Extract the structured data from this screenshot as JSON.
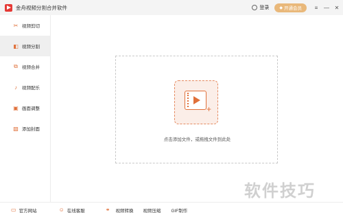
{
  "titlebar": {
    "app_title": "金舟视频分割合并软件",
    "login_label": "登录",
    "vip_label": "开通会员",
    "vip_icon": "diamond-icon",
    "menu_glyph": "≡",
    "minimize_glyph": "—",
    "close_glyph": "✕"
  },
  "sidebar": {
    "items": [
      {
        "label": "视频剪切",
        "icon": "scissors-icon",
        "glyph": "✂"
      },
      {
        "label": "视频分割",
        "icon": "split-icon",
        "glyph": "◧"
      },
      {
        "label": "视频合并",
        "icon": "merge-icon",
        "glyph": "⧉"
      },
      {
        "label": "视频配乐",
        "icon": "music-icon",
        "glyph": "♪"
      },
      {
        "label": "画面调整",
        "icon": "adjust-icon",
        "glyph": "▣"
      },
      {
        "label": "添加封面",
        "icon": "cover-icon",
        "glyph": "▧"
      }
    ],
    "active_index": 1
  },
  "main": {
    "drop_text": "点击添加文件，或拖拽文件到此处",
    "plus_glyph": "+"
  },
  "bottombar": {
    "website_label": "官方网站",
    "support_label": "在线客服",
    "convert_label": "视频转换",
    "compress_label": "视频压缩",
    "gif_label": "GIF制作"
  },
  "watermark": "软件技巧",
  "colors": {
    "accent": "#e0703a",
    "vip": "#e9b87a",
    "logo": "#e53935"
  }
}
